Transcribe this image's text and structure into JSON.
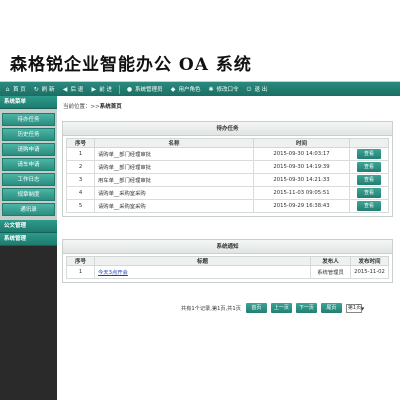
{
  "header": {
    "title": "森格锐企业智能办公 OA 系统"
  },
  "toolbar": {
    "items": [
      {
        "label": "首 页"
      },
      {
        "label": "刷 新"
      },
      {
        "label": "后 退"
      },
      {
        "label": "前 进"
      },
      {
        "label": "系统管理员"
      },
      {
        "label": "用户角色"
      },
      {
        "label": "修改口令"
      },
      {
        "label": "退 出"
      }
    ]
  },
  "sidebar": {
    "group1": "系统菜单",
    "items": [
      {
        "label": "待办任务"
      },
      {
        "label": "历史任务"
      },
      {
        "label": "请购申请"
      },
      {
        "label": "请车申请"
      },
      {
        "label": "工作日志"
      },
      {
        "label": "规章制度"
      },
      {
        "label": "通讯录"
      }
    ],
    "group2": "公文管理",
    "group3": "系统管理"
  },
  "breadcrumb": {
    "prefix": "当前位置：>>",
    "current": "系统首页"
  },
  "tasks": {
    "title": "待办任务",
    "headers": [
      "序号",
      "名称",
      "时间",
      ""
    ],
    "rows": [
      {
        "no": "1",
        "name": "请购单__部门经理审批",
        "time": "2015-09-30 14:03:17",
        "action": "查看"
      },
      {
        "no": "2",
        "name": "请购单__部门经理审批",
        "time": "2015-09-30 14:19:39",
        "action": "查看"
      },
      {
        "no": "3",
        "name": "用车单__部门经理审批",
        "time": "2015-09-30 14:21:33",
        "action": "查看"
      },
      {
        "no": "4",
        "name": "请购单__采购室采购",
        "time": "2015-11-03 09:05:51",
        "action": "查看"
      },
      {
        "no": "5",
        "name": "请购单__采购室采购",
        "time": "2015-09-29 16:38:43",
        "action": "查看"
      }
    ]
  },
  "notices": {
    "title": "系统通知",
    "headers": [
      "序号",
      "标题",
      "发布人",
      "发布时间"
    ],
    "rows": [
      {
        "no": "1",
        "title": "今天3点开会",
        "publisher": "系统管理员",
        "date": "2015-11-02"
      }
    ]
  },
  "pager": {
    "summary": "共有1个记录,第1页,共1页",
    "first": "首页",
    "prev": "上一页",
    "next": "下一页",
    "last": "尾页",
    "page": "第1页"
  }
}
